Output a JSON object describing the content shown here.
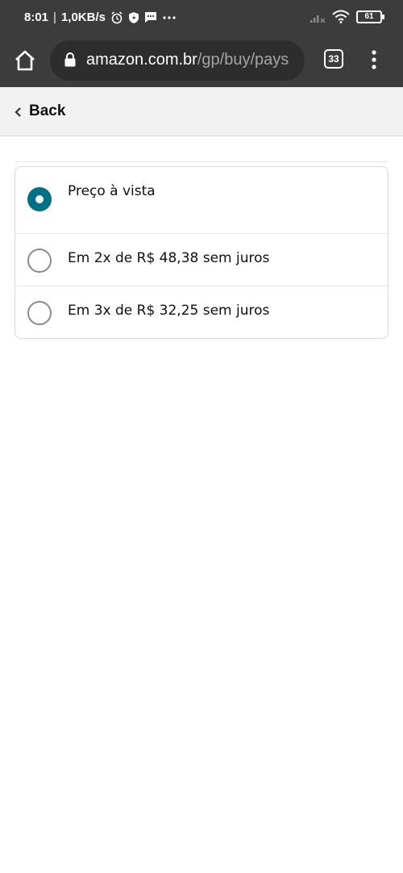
{
  "status_bar": {
    "time": "8:01",
    "network_speed": "1,0KB/s",
    "battery": "61"
  },
  "browser": {
    "url_domain": "amazon.com.br",
    "url_path": "/gp/buy/pays",
    "tab_count": "33"
  },
  "nav": {
    "back_label": "Back"
  },
  "payment_options": [
    {
      "label": "Preço à vista",
      "selected": true
    },
    {
      "label": "Em 2x de R$ 48,38 sem juros",
      "selected": false
    },
    {
      "label": "Em 3x de R$ 32,25 sem juros",
      "selected": false
    }
  ],
  "colors": {
    "status_bar_bg": "#3c3c3c",
    "radio_selected": "#007185",
    "back_bar_bg": "#f2f2f2"
  }
}
